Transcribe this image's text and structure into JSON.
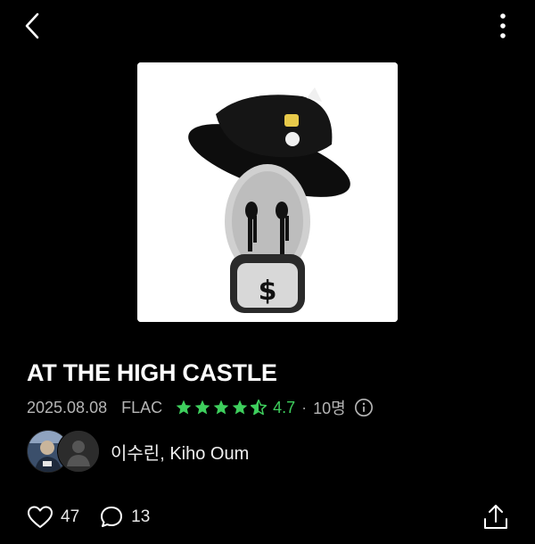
{
  "header": {
    "back_icon": "chevron-left-icon",
    "more_icon": "more-vertical-icon"
  },
  "album": {
    "cover_icon": "album-cover-art",
    "title": "AT THE HIGH CASTLE",
    "date": "2025.08.08",
    "format": "FLAC",
    "stars": 4.5,
    "rating": "4.7",
    "separator": "·",
    "rating_count": "10명",
    "info_icon": "info-icon",
    "star_color": "#3ecf5d"
  },
  "artists": {
    "names": "이수린, Kiho Oum",
    "avatar_icons": [
      "artist-avatar",
      "default-user-icon"
    ]
  },
  "actions": {
    "like_count": "47",
    "comment_count": "13",
    "like_icon": "heart-icon",
    "comment_icon": "comment-icon",
    "share_icon": "share-icon"
  }
}
